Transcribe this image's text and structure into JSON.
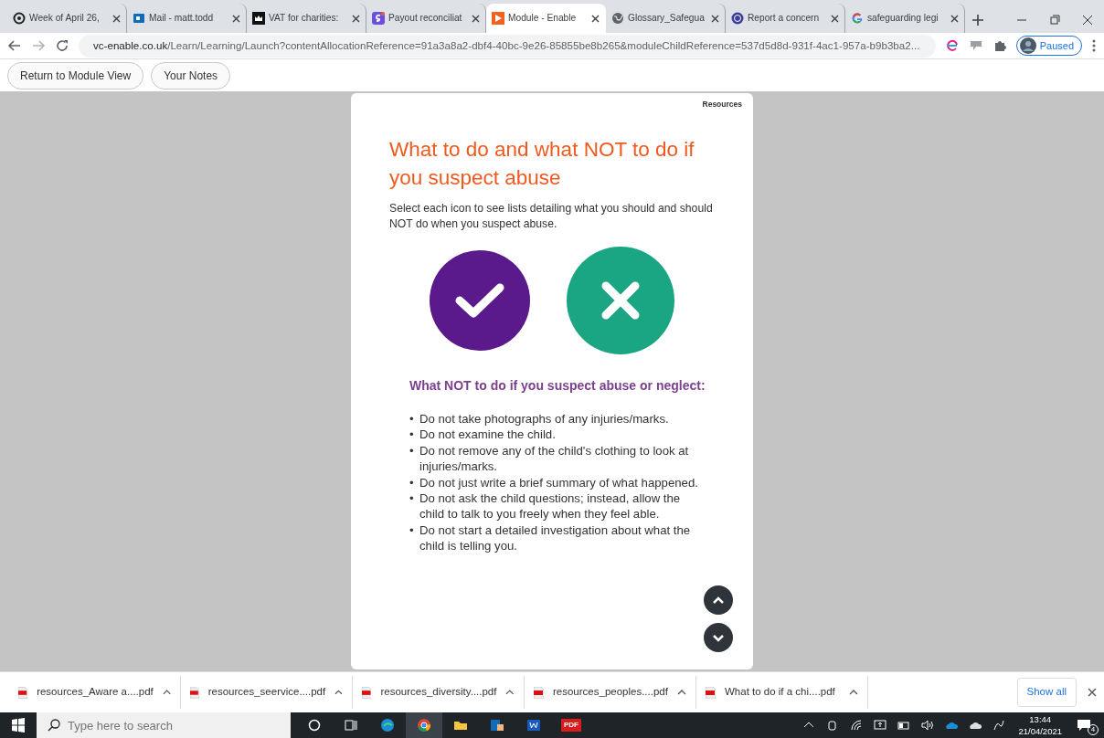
{
  "tabs": [
    {
      "label": "Week of April 26,",
      "selected": false
    },
    {
      "label": "Mail - matt.todd",
      "selected": false
    },
    {
      "label": "VAT for charities:",
      "selected": false
    },
    {
      "label": "Payout reconciliat",
      "selected": false
    },
    {
      "label": "Module - Enable",
      "selected": true
    },
    {
      "label": "Glossary_Safegua",
      "selected": false
    },
    {
      "label": "Report a concern",
      "selected": false
    },
    {
      "label": "safeguarding legi",
      "selected": false
    }
  ],
  "address": {
    "domain": "vc-enable.co.uk",
    "path": "/Learn/Learning/Launch?contentAllocationReference=91a3a8a2-dbf4-40bc-9e26-85855be8b265&moduleChildReference=537d5d8d-931f-4ac1-957a-b9b3ba2..."
  },
  "profile": {
    "label": "Paused"
  },
  "page_buttons": [
    "Return to Module View",
    "Your Notes"
  ],
  "module": {
    "resources": "Resources",
    "title": "What to do and what NOT to do if you suspect abuse",
    "intro": "Select each icon to see lists detailing what you should and should NOT do when you suspect abuse.",
    "choices": [
      {
        "kind": "check",
        "selected": false
      },
      {
        "kind": "cross",
        "selected": true
      }
    ],
    "subheading": "What NOT to do if you suspect abuse or neglect:",
    "items": [
      {
        "bullet": "•",
        "text": "Do not take photographs of any injuries/marks."
      },
      {
        "bullet": "•",
        "text": "Do not examine the child."
      },
      {
        "bullet": "•",
        "text": "Do not remove any of the child's clothing to look at injuries/marks."
      },
      {
        "bullet": "•",
        "text": "Do not just write a brief summary of what happened."
      },
      {
        "bullet": "•",
        "text": "Do not ask the child questions; instead, allow the child to talk to you freely when they feel able."
      },
      {
        "bullet": "•",
        "text": "Do not start a detailed investigation about what the child is telling you."
      }
    ]
  },
  "downloads": {
    "files": [
      "resources_Aware a....pdf",
      "resources_seervice....pdf",
      "resources_diversity....pdf",
      "resources_peoples....pdf",
      "What to do if a chi....pdf"
    ],
    "show_all": "Show all"
  },
  "taskbar": {
    "search_placeholder": "Type here to search",
    "pdf_label": "PDF",
    "time": "13:44",
    "date": "21/04/2021",
    "notifications": "4"
  }
}
